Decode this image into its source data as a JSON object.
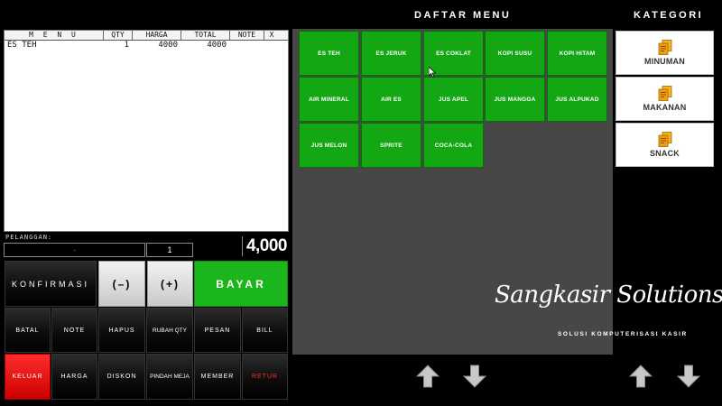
{
  "order": {
    "columns": {
      "menu": "M E N U",
      "qty": "QTY",
      "harga": "HARGA",
      "total": "TOTAL",
      "note": "NOTE",
      "close": "X"
    },
    "rows": [
      {
        "menu": "ES TEH",
        "qty": "1",
        "harga": "4000",
        "total": "4000"
      }
    ]
  },
  "customer": {
    "label": "PELANGGAN:",
    "value": "-",
    "qty": "1"
  },
  "grand_total": "4,000",
  "actions": {
    "konfirmasi": "KONFIRMASI",
    "minus": "(–)",
    "plus": "(+)",
    "bayar": "BAYAR",
    "batal": "BATAL",
    "note": "NOTE",
    "hapus": "HAPUS",
    "rubah_qty": "RUBAH QTY",
    "pesan": "PESAN",
    "bill": "BILL",
    "keluar": "KELUAR",
    "harga": "HARGA",
    "diskon": "DISKON",
    "pindah_meja": "PINDAH MEJA",
    "member": "MEMBER",
    "retur": "RETUR"
  },
  "menu": {
    "title": "DAFTAR MENU",
    "items": [
      "ES TEH",
      "ES JERUK",
      "ES COKLAT",
      "KOPI SUSU",
      "KOPI HITAM",
      "AIR MINERAL",
      "AIR ES",
      "JUS APEL",
      "JUS MANGGA",
      "JUS ALPUKAD",
      "JUS MELON",
      "SPRITE",
      "COCA-COLA"
    ]
  },
  "kategori": {
    "title": "KATEGORI",
    "items": [
      "MINUMAN",
      "MAKANAN",
      "SNACK"
    ]
  },
  "brand": {
    "name": "Sangkasir Solutions",
    "tagline": "SOLUSI KOMPUTERISASI KASIR"
  },
  "colors": {
    "menu_green": "#13a713",
    "bayar_green": "#1bb61b",
    "keluar_red": "#ff2d2d",
    "menu_bg": "#474747"
  },
  "icons": {
    "arrow_up": "arrow-up-icon",
    "arrow_down": "arrow-down-icon",
    "category": "document-icon"
  }
}
